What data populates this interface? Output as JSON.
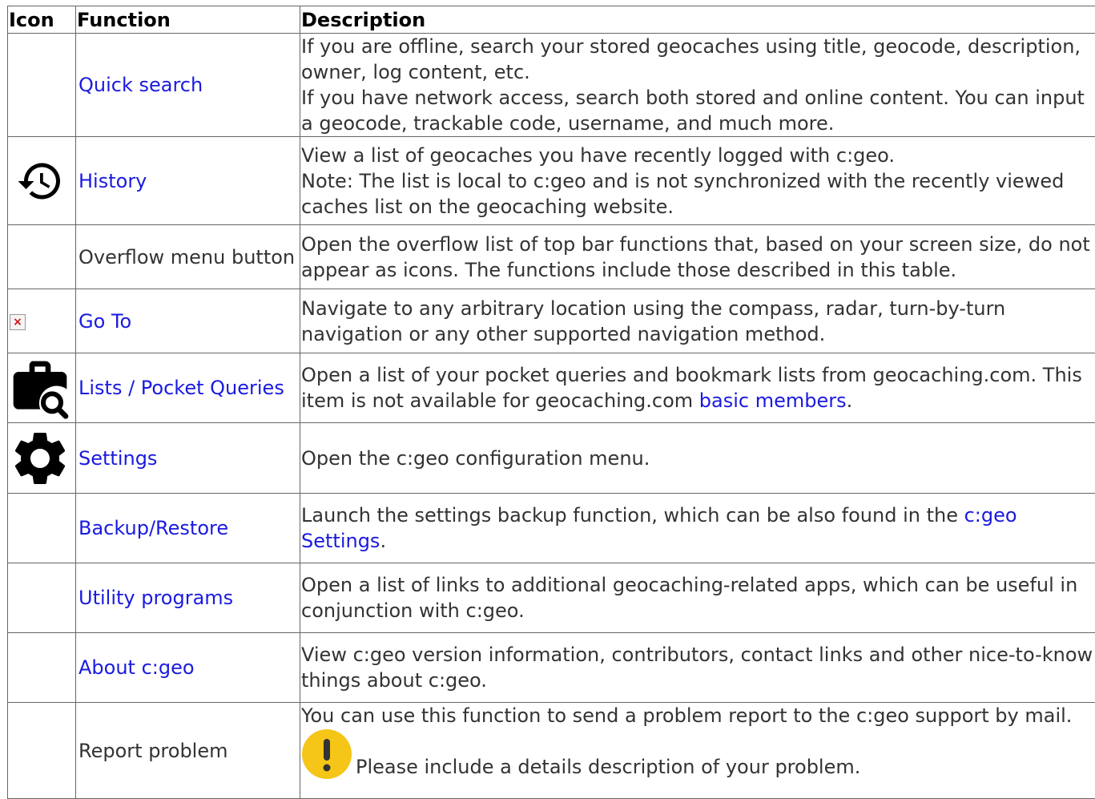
{
  "headers": {
    "icon": "Icon",
    "function": "Function",
    "description": "Description"
  },
  "rows": [
    {
      "icon": "none",
      "function": "Quick search",
      "description": [
        "If you are offline, search your stored geocaches using title, geocode, description, owner, log content, etc.",
        "If you have network access, search both stored and online content. You can input a geocode, trackable code, username, and much more."
      ]
    },
    {
      "icon": "history-icon",
      "function": "History",
      "description": [
        "View a list of geocaches you have recently logged with c:geo.",
        "Note: The list is local to c:geo and is not synchronized with the recently viewed caches list on the geocaching website."
      ]
    },
    {
      "icon": "none",
      "function": "Overflow menu button",
      "description": [
        "Open the overflow list of top bar functions that, based on your screen size, do not appear as icons. The functions include those described in this table."
      ]
    },
    {
      "icon": "broken-image-icon",
      "function": "Go To",
      "description": [
        "Navigate to any arbitrary location using the compass, radar, turn-by-turn navigation or any other supported navigation method."
      ]
    },
    {
      "icon": "briefcase-search-icon",
      "function": "Lists / Pocket Queries",
      "description_before": "Open a list of your pocket queries and bookmark lists from geocaching.com. This item is not available for geocaching.com ",
      "description_link": "basic members",
      "description_after": "."
    },
    {
      "icon": "gear-icon",
      "function": "Settings",
      "description": [
        "Open the c:geo configuration menu."
      ]
    },
    {
      "icon": "none",
      "function": "Backup/Restore",
      "description_before": "Launch the settings backup function, which can be also found in the ",
      "description_link": "c:geo Settings",
      "description_after": "."
    },
    {
      "icon": "none",
      "function": "Utility programs",
      "description": [
        "Open a list of links to additional geocaching-related apps, which can be useful in conjunction with c:geo."
      ]
    },
    {
      "icon": "none",
      "function": "About c:geo",
      "description": [
        "View c:geo version information, contributors, contact links and other nice-to-know things about c:geo."
      ]
    },
    {
      "icon": "none",
      "function": "Report problem",
      "description": [
        "You can use this function to send a problem report to the c:geo support by mail."
      ],
      "note": "Please include a details description of your problem."
    }
  ],
  "colors": {
    "link": "#1a1ae0",
    "text": "#333333",
    "border": "#666666",
    "note_icon": "#f5c518"
  }
}
